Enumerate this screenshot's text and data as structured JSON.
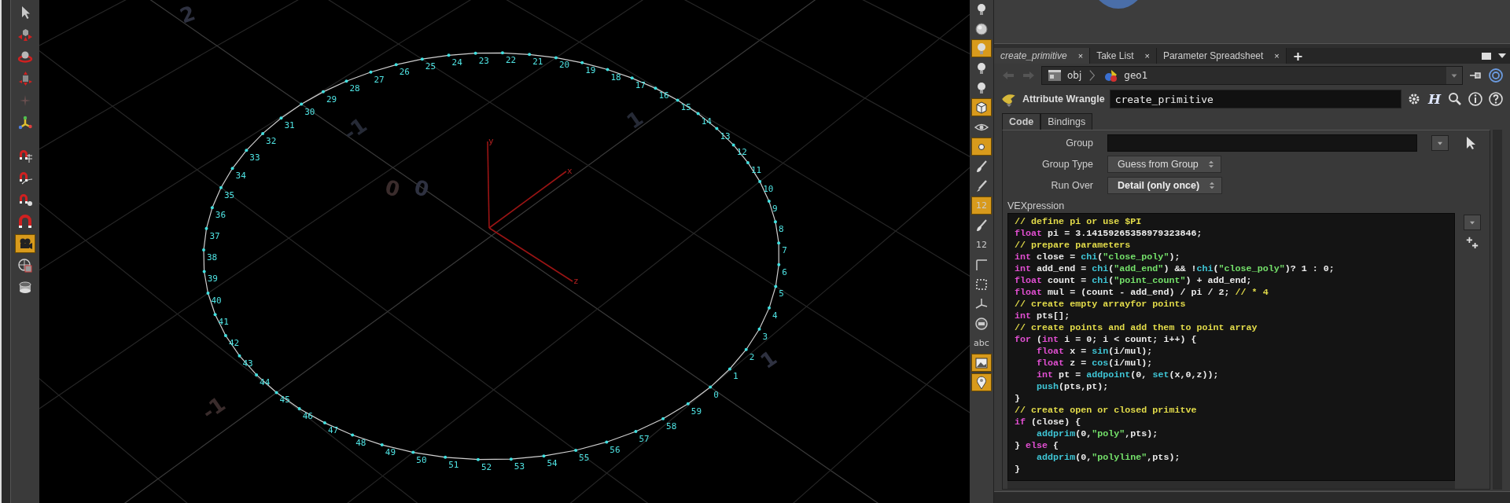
{
  "left_toolbar": {
    "tools": [
      {
        "kind": "select",
        "selected": false
      },
      {
        "kind": "transform",
        "selected": false
      },
      {
        "kind": "rotate",
        "selected": false
      },
      {
        "kind": "scale",
        "selected": false
      },
      {
        "kind": "handle",
        "selected": false
      },
      {
        "kind": "pose",
        "selected": false
      },
      {
        "kind": "snap-grid",
        "selected": false
      },
      {
        "kind": "snap-curve",
        "selected": false
      },
      {
        "kind": "snap-point",
        "selected": false
      },
      {
        "kind": "snap-magnet",
        "selected": false
      },
      {
        "kind": "camera",
        "selected": true
      },
      {
        "kind": "view",
        "selected": false
      },
      {
        "kind": "lens",
        "selected": false
      }
    ]
  },
  "viewport": {
    "grid_labels": [
      "2",
      "-1",
      "1",
      "0",
      "0",
      "-1",
      "1"
    ],
    "axis_labels": [
      "y",
      "x",
      "z"
    ],
    "point_labels": {
      "top_arc": [
        "29",
        "28",
        "27",
        "26",
        "25",
        "24",
        "23",
        "22",
        "21",
        "20",
        "19",
        "18",
        "17",
        "16"
      ],
      "right_arc": [
        "15",
        "14",
        "13",
        "12",
        "11",
        "10",
        "9",
        "8",
        "7",
        "6",
        "5",
        "4",
        "3",
        "2",
        "1",
        "0"
      ],
      "left_arc": [
        "30",
        "31",
        "32",
        "33",
        "34",
        "35",
        "36",
        "37",
        "38",
        "39",
        "40",
        "41",
        "42",
        "43",
        "44"
      ],
      "bottom_arc": [
        "45",
        "46",
        "47",
        "48",
        "49",
        "50",
        "51",
        "52",
        "53",
        "54",
        "55",
        "56",
        "57",
        "58",
        "59"
      ]
    }
  },
  "shelf": {
    "tools": [
      {
        "kind": "light",
        "selected": false
      },
      {
        "kind": "sphere",
        "selected": false
      },
      {
        "kind": "light",
        "selected": true
      },
      {
        "kind": "light",
        "selected": false
      },
      {
        "kind": "light",
        "selected": false
      },
      {
        "kind": "cube",
        "selected": true
      },
      {
        "kind": "eye",
        "selected": false
      },
      {
        "kind": "dot",
        "selected": true
      },
      {
        "kind": "brush",
        "selected": false
      },
      {
        "kind": "pen",
        "selected": false
      },
      {
        "kind": "label",
        "label": "12",
        "selected": true
      },
      {
        "kind": "brush",
        "selected": false
      },
      {
        "kind": "label",
        "label": "12",
        "selected": false
      },
      {
        "kind": "corner",
        "selected": false
      },
      {
        "kind": "grid",
        "selected": false
      },
      {
        "kind": "axis",
        "selected": false
      },
      {
        "kind": "circle",
        "selected": false
      },
      {
        "kind": "label",
        "label": "abc",
        "selected": false
      },
      {
        "kind": "image",
        "selected": true
      },
      {
        "kind": "pin",
        "selected": true
      }
    ]
  },
  "panel": {
    "tabs": [
      {
        "label": "create_primitive",
        "close": "×",
        "selected": true
      },
      {
        "label": "Take List",
        "close": "×",
        "selected": false
      },
      {
        "label": "Parameter Spreadsheet",
        "close": "×",
        "selected": false
      }
    ],
    "add_tab": "+",
    "path": [
      "obj",
      "geo1"
    ],
    "node_type": "Attribute Wrangle",
    "node_name": "create_primitive",
    "help_letter": "H",
    "parm_tabs": [
      {
        "label": "Code",
        "selected": true
      },
      {
        "label": "Bindings",
        "selected": false
      }
    ],
    "parms": [
      {
        "kind": "field",
        "label": "Group"
      },
      {
        "kind": "menu",
        "label": "Group Type",
        "value": "Guess from Group",
        "changed": false
      },
      {
        "kind": "menu",
        "label": "Run Over",
        "value": "Detail (only once)",
        "changed": true
      }
    ],
    "code_label": "VEXpression",
    "code_lines": [
      [
        {
          "kind": "comment",
          "text": "// define pi or use $PI"
        }
      ],
      [
        {
          "kind": "keyword",
          "text": "float"
        },
        {
          "kind": "plain",
          "text": " pi = 3.14159265358979323846;"
        }
      ],
      [
        {
          "kind": "comment",
          "text": "// prepare parameters"
        }
      ],
      [
        {
          "kind": "keyword",
          "text": "int"
        },
        {
          "kind": "plain",
          "text": " close = "
        },
        {
          "kind": "function",
          "text": "chi"
        },
        {
          "kind": "plain",
          "text": "("
        },
        {
          "kind": "string",
          "text": "\"close_poly\""
        },
        {
          "kind": "plain",
          "text": ");"
        }
      ],
      [
        {
          "kind": "keyword",
          "text": "int"
        },
        {
          "kind": "plain",
          "text": " add_end = "
        },
        {
          "kind": "function",
          "text": "chi"
        },
        {
          "kind": "plain",
          "text": "("
        },
        {
          "kind": "string",
          "text": "\"add_end\""
        },
        {
          "kind": "plain",
          "text": ") && !"
        },
        {
          "kind": "function",
          "text": "chi"
        },
        {
          "kind": "plain",
          "text": "("
        },
        {
          "kind": "string",
          "text": "\"close_poly\""
        },
        {
          "kind": "plain",
          "text": ")? 1 : 0;"
        }
      ],
      [
        {
          "kind": "keyword",
          "text": "float"
        },
        {
          "kind": "plain",
          "text": " count = "
        },
        {
          "kind": "function",
          "text": "chi"
        },
        {
          "kind": "plain",
          "text": "("
        },
        {
          "kind": "string",
          "text": "\"point_count\""
        },
        {
          "kind": "plain",
          "text": ") + add_end;"
        }
      ],
      [
        {
          "kind": "keyword",
          "text": "float"
        },
        {
          "kind": "plain",
          "text": " mul = (count - add_end) / pi / 2; "
        },
        {
          "kind": "comment",
          "text": "// * 4"
        }
      ],
      [
        {
          "kind": "comment",
          "text": "// create empty arrayfor points"
        }
      ],
      [
        {
          "kind": "keyword",
          "text": "int"
        },
        {
          "kind": "plain",
          "text": " pts[];"
        }
      ],
      [
        {
          "kind": "comment",
          "text": "// create points and add them to point array"
        }
      ],
      [
        {
          "kind": "keyword",
          "text": "for"
        },
        {
          "kind": "plain",
          "text": " ("
        },
        {
          "kind": "keyword",
          "text": "int"
        },
        {
          "kind": "plain",
          "text": " i = 0; i < count; i++) {"
        }
      ],
      [
        {
          "kind": "keyword",
          "text": "    float"
        },
        {
          "kind": "plain",
          "text": " x = "
        },
        {
          "kind": "function",
          "text": "sin"
        },
        {
          "kind": "plain",
          "text": "(i/mul);"
        }
      ],
      [
        {
          "kind": "keyword",
          "text": "    float"
        },
        {
          "kind": "plain",
          "text": " z = "
        },
        {
          "kind": "function",
          "text": "cos"
        },
        {
          "kind": "plain",
          "text": "(i/mul);"
        }
      ],
      [
        {
          "kind": "keyword",
          "text": "    int"
        },
        {
          "kind": "plain",
          "text": " pt = "
        },
        {
          "kind": "function",
          "text": "addpoint"
        },
        {
          "kind": "plain",
          "text": "(0, "
        },
        {
          "kind": "function",
          "text": "set"
        },
        {
          "kind": "plain",
          "text": "(x,0,z));"
        }
      ],
      [
        {
          "kind": "function",
          "text": "    push"
        },
        {
          "kind": "plain",
          "text": "(pts,pt);"
        }
      ],
      [
        {
          "kind": "plain",
          "text": "}"
        }
      ],
      [
        {
          "kind": "comment",
          "text": "// create open or closed primitve"
        }
      ],
      [
        {
          "kind": "keyword",
          "text": "if"
        },
        {
          "kind": "plain",
          "text": " (close) {"
        }
      ],
      [
        {
          "kind": "function",
          "text": "    addprim"
        },
        {
          "kind": "plain",
          "text": "(0,"
        },
        {
          "kind": "string",
          "text": "\"poly\""
        },
        {
          "kind": "plain",
          "text": ",pts);"
        }
      ],
      [
        {
          "kind": "plain",
          "text": "} "
        },
        {
          "kind": "keyword",
          "text": "else"
        },
        {
          "kind": "plain",
          "text": " {"
        }
      ],
      [
        {
          "kind": "function",
          "text": "    addprim"
        },
        {
          "kind": "plain",
          "text": "(0,"
        },
        {
          "kind": "string",
          "text": "\"polyline\""
        },
        {
          "kind": "plain",
          "text": ",pts);"
        }
      ],
      [
        {
          "kind": "plain",
          "text": "}"
        }
      ]
    ]
  }
}
